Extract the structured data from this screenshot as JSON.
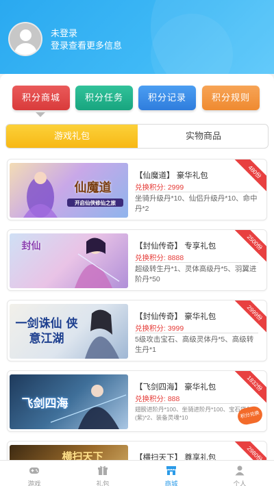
{
  "header": {
    "user_name": "未登录",
    "user_sub": "登录查看更多信息"
  },
  "quick_actions": [
    "积分商城",
    "积分任务",
    "积分记录",
    "积分规则"
  ],
  "tabs": {
    "game_gifts": "游戏礼包",
    "physical_goods": "实物商品"
  },
  "gifts": [
    {
      "title": "【仙魔道】 豪华礼包",
      "points": "兑换积分: 2999",
      "desc": "坐骑升级丹*10、仙侣升级丹*10、命中丹*2",
      "ribbon": "480份",
      "thumb_text": "仙魔道",
      "thumb_sub": "开启仙侠修仙之旅"
    },
    {
      "title": "【封仙传奇】 专享礼包",
      "points": "兑换积分: 8888",
      "desc": "超级转生丹*1、灵体高级丹*5、羽翼进阶丹*50",
      "ribbon": "2500份",
      "thumb_text": "封仙"
    },
    {
      "title": "【封仙传奇】 豪华礼包",
      "points": "兑换积分: 3999",
      "desc": "5级攻击宝石、高级灵体丹*5、高级转生丹*1",
      "ribbon": "2999份",
      "thumb_text": "一剑诛仙 侠意江湖"
    },
    {
      "title": "【飞剑四海】 豪华礼包",
      "points": "兑换积分: 888",
      "desc": "翅膀进阶丹*100、坐骑进阶丹*100、宝石袋包(紫)*2、装备灵魂*10",
      "ribbon": "1832份",
      "thumb_text": "飞剑四海",
      "stamp": "积分兑换"
    },
    {
      "title": "【横扫天下】 尊享礼包",
      "points": "",
      "desc": "",
      "ribbon": "2980份",
      "thumb_text": "横扫天下"
    }
  ],
  "tabbar": [
    "游戏",
    "礼包",
    "商城",
    "个人"
  ]
}
